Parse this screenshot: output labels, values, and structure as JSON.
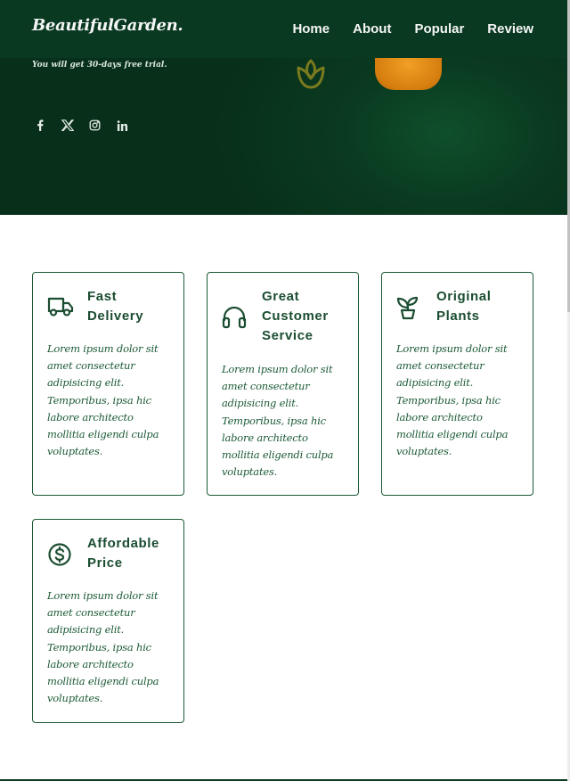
{
  "brand": {
    "logo": "BeautifulGarden."
  },
  "nav": {
    "links": [
      "Home",
      "About",
      "Popular",
      "Review"
    ]
  },
  "hero": {
    "trial_text": "You will get 30-days free trial.",
    "socials": [
      "facebook-icon",
      "x-twitter-icon",
      "instagram-icon",
      "linkedin-icon"
    ]
  },
  "colors": {
    "hero_bg": "#0a3a20",
    "accent": "#1b5a36",
    "pot": "#e08a18"
  },
  "features": [
    {
      "icon": "truck-icon",
      "title": "Fast Delivery",
      "text": "Lorem ipsum dolor sit amet consectetur adipisicing elit. Temporibus, ipsa hic labore architecto mollitia eligendi culpa voluptates."
    },
    {
      "icon": "headset-icon",
      "title": "Great Customer Service",
      "text": "Lorem ipsum dolor sit amet consectetur adipisicing elit. Temporibus, ipsa hic labore architecto mollitia eligendi culpa voluptates."
    },
    {
      "icon": "plant-icon",
      "title": "Original Plants",
      "text": "Lorem ipsum dolor sit amet consectetur adipisicing elit. Temporibus, ipsa hic labore architecto mollitia eligendi culpa voluptates."
    },
    {
      "icon": "dollar-circle-icon",
      "title": "Affordable Price",
      "text": "Lorem ipsum dolor sit amet consectetur adipisicing elit. Temporibus, ipsa hic labore architecto mollitia eligendi culpa voluptates."
    }
  ]
}
